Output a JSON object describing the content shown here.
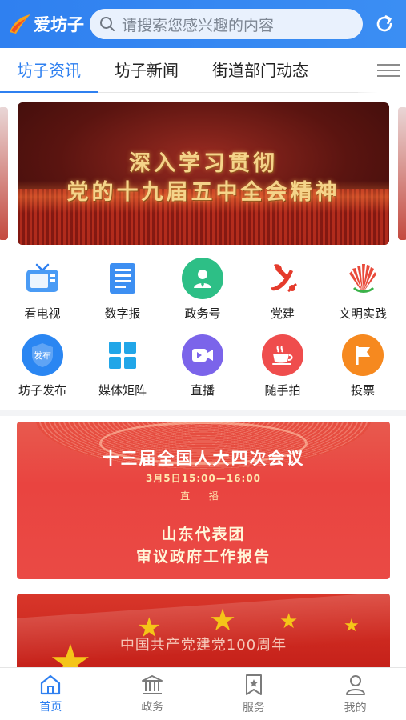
{
  "header": {
    "brand": "爱坊子",
    "search_placeholder": "请搜索您感兴趣的内容"
  },
  "tabs": [
    {
      "label": "坊子资讯",
      "active": true
    },
    {
      "label": "坊子新闻",
      "active": false
    },
    {
      "label": "街道部门动态",
      "active": false
    }
  ],
  "banner": {
    "line1": "深入学习贯彻",
    "line2": "党的十九届五中全会精神"
  },
  "services": [
    {
      "label": "看电视",
      "icon": "tv-icon"
    },
    {
      "label": "数字报",
      "icon": "newspaper-icon"
    },
    {
      "label": "政务号",
      "icon": "official-account-icon"
    },
    {
      "label": "党建",
      "icon": "party-emblem-icon"
    },
    {
      "label": "文明实践",
      "icon": "civilization-icon"
    },
    {
      "label": "坊子发布",
      "icon": "release-shield-icon",
      "badge": "发布"
    },
    {
      "label": "媒体矩阵",
      "icon": "matrix-grid-icon"
    },
    {
      "label": "直播",
      "icon": "video-live-icon"
    },
    {
      "label": "随手拍",
      "icon": "coffee-cup-icon"
    },
    {
      "label": "投票",
      "icon": "flag-icon"
    }
  ],
  "cards": {
    "card1": {
      "title": "十三届全国人大四次会议",
      "time": "3月5日15:00—16:00",
      "live": "直 播",
      "subtitle1": "山东代表团",
      "subtitle2": "审议政府工作报告"
    },
    "card2": {
      "title": "中国共产党建党100周年"
    }
  },
  "bottom_nav": [
    {
      "label": "首页",
      "icon": "home-icon",
      "active": true
    },
    {
      "label": "政务",
      "icon": "government-building-icon",
      "active": false
    },
    {
      "label": "服务",
      "icon": "service-bookmark-icon",
      "active": false
    },
    {
      "label": "我的",
      "icon": "user-icon",
      "active": false
    }
  ],
  "colors": {
    "primary": "#2f80f0",
    "banner_red": "#9a2b21",
    "card_red": "#e94440"
  }
}
